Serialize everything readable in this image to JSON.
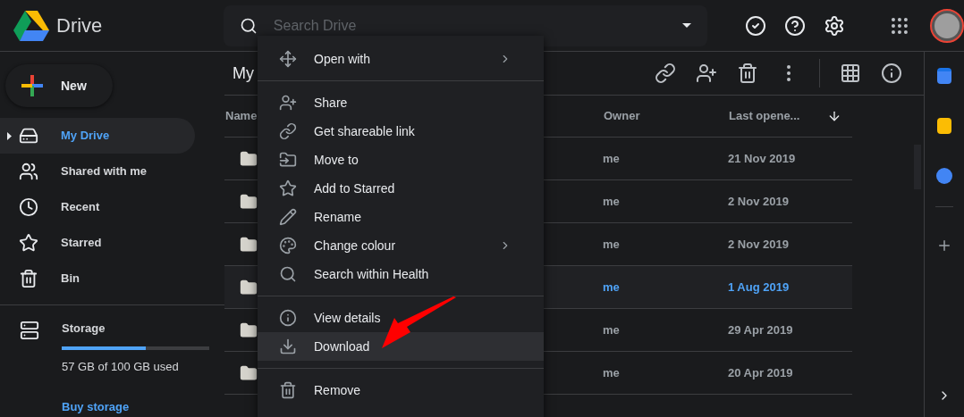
{
  "header": {
    "app_name": "Drive",
    "search": {
      "placeholder": "Search Drive"
    }
  },
  "sidebar": {
    "new_button": "New",
    "items": [
      {
        "label": "My Drive",
        "selected": true
      },
      {
        "label": "Shared with me",
        "selected": false
      },
      {
        "label": "Recent",
        "selected": false
      },
      {
        "label": "Starred",
        "selected": false
      },
      {
        "label": "Bin",
        "selected": false
      }
    ],
    "storage": {
      "label": "Storage",
      "level": 0.57,
      "usage": "57 GB of 100 GB used",
      "buy": "Buy storage"
    }
  },
  "main": {
    "title": "My",
    "columns": [
      "Name",
      "Owner",
      "Last opene..."
    ],
    "rows": [
      {
        "owner": "me",
        "last_opened": "21 Nov 2019",
        "selected": false
      },
      {
        "owner": "me",
        "last_opened": "2 Nov 2019",
        "selected": false
      },
      {
        "owner": "me",
        "last_opened": "2 Nov 2019",
        "selected": false
      },
      {
        "owner": "me",
        "last_opened": "1 Aug 2019",
        "selected": true
      },
      {
        "owner": "me",
        "last_opened": "29 Apr 2019",
        "selected": false
      },
      {
        "owner": "me",
        "last_opened": "20 Apr 2019",
        "selected": false
      }
    ]
  },
  "context_menu": {
    "groups": [
      [
        {
          "label": "Open with",
          "submenu": true,
          "selected": false
        }
      ],
      [
        {
          "label": "Share",
          "submenu": false,
          "selected": false
        },
        {
          "label": "Get shareable link",
          "submenu": false,
          "selected": false
        },
        {
          "label": "Move to",
          "submenu": false,
          "selected": false
        },
        {
          "label": "Add to Starred",
          "submenu": false,
          "selected": false
        },
        {
          "label": "Rename",
          "submenu": false,
          "selected": false
        },
        {
          "label": "Change colour",
          "submenu": true,
          "selected": false
        },
        {
          "label": "Search within Health",
          "submenu": false,
          "selected": false
        }
      ],
      [
        {
          "label": "View details",
          "submenu": false,
          "selected": false
        },
        {
          "label": "Download",
          "submenu": false,
          "selected": true
        }
      ],
      [
        {
          "label": "Remove",
          "submenu": false,
          "selected": false
        }
      ]
    ]
  }
}
